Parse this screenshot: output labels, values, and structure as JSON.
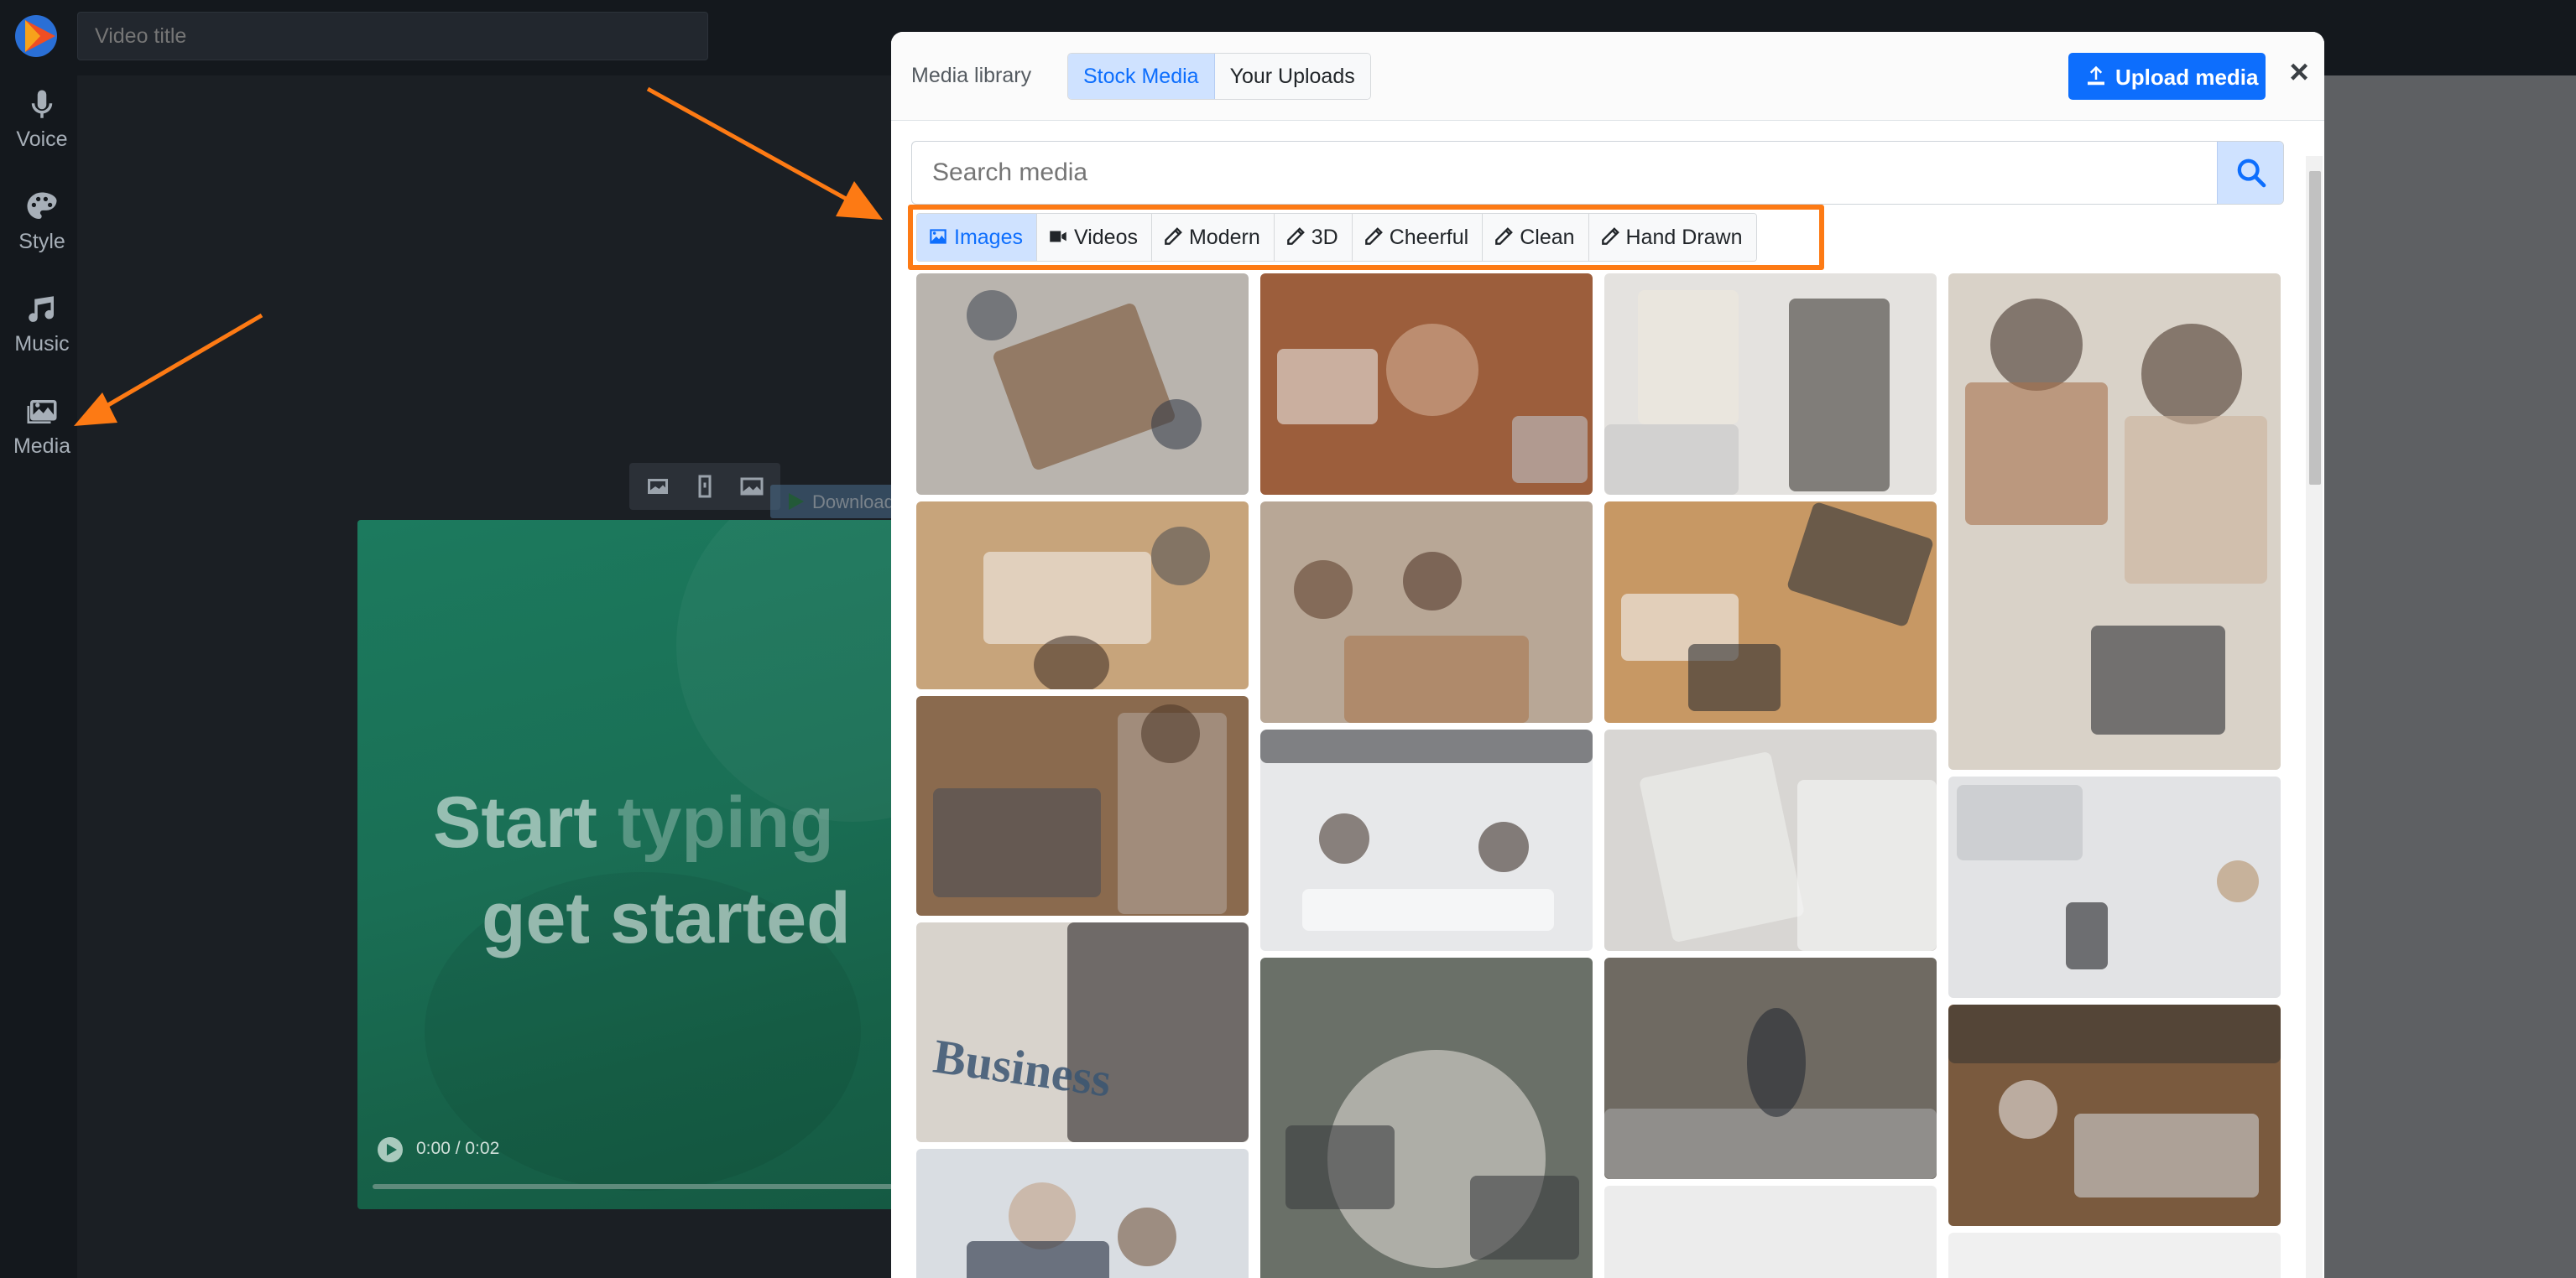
{
  "app": {
    "title_placeholder": "Video title"
  },
  "sidebar": {
    "items": [
      {
        "label": "Voice",
        "icon": "microphone-icon"
      },
      {
        "label": "Style",
        "icon": "palette-icon"
      },
      {
        "label": "Music",
        "icon": "music-note-icon"
      },
      {
        "label": "Media",
        "icon": "images-icon"
      }
    ]
  },
  "editor": {
    "toolbar_icons": [
      "image-icon",
      "portrait-icon",
      "landscape-image-icon"
    ],
    "download_label": "Download the audio",
    "preview": {
      "line1_a": "Start ",
      "line1_b": "typing",
      "line2": "get started",
      "timecode": "0:00 / 0:02",
      "progress": 0
    }
  },
  "modal": {
    "title": "Media library",
    "tabs": [
      {
        "label": "Stock Media",
        "active": true
      },
      {
        "label": "Your Uploads",
        "active": false
      }
    ],
    "upload_label": "Upload media",
    "close_label": "×",
    "search_placeholder": "Search media",
    "filters": [
      {
        "label": "Images",
        "icon": "image-icon",
        "active": true
      },
      {
        "label": "Videos",
        "icon": "video-camera-icon",
        "active": false
      },
      {
        "label": "Modern",
        "icon": "pencil-icon",
        "active": false
      },
      {
        "label": "3D",
        "icon": "pencil-icon",
        "active": false
      },
      {
        "label": "Cheerful",
        "icon": "pencil-icon",
        "active": false
      },
      {
        "label": "Clean",
        "icon": "pencil-icon",
        "active": false
      },
      {
        "label": "Hand Drawn",
        "icon": "pencil-icon",
        "active": false
      }
    ],
    "thumbnail_caption": "Business",
    "colors": {
      "primary": "#0d6efd",
      "active_tab_bg": "#cfe2ff",
      "highlight": "#fd7a14"
    }
  }
}
